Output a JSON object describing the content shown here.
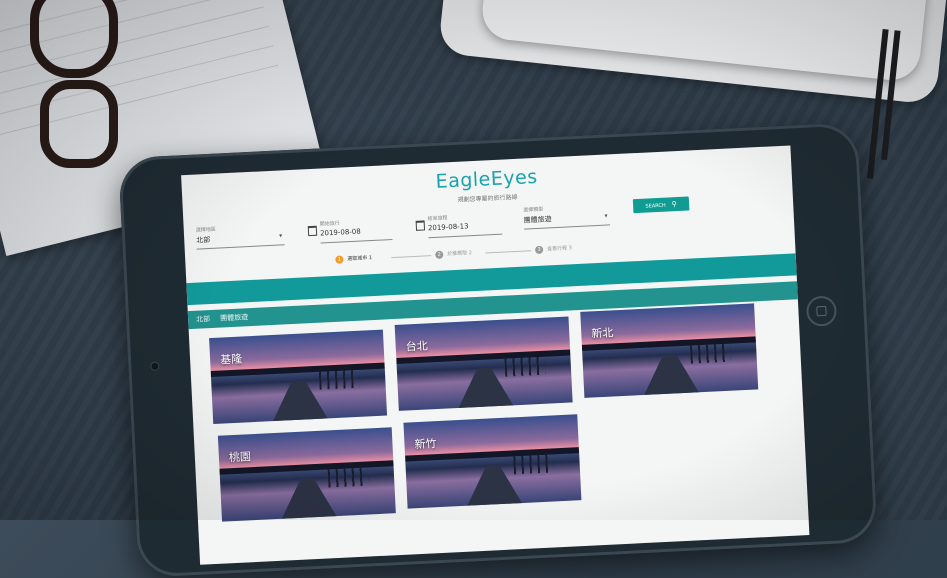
{
  "app": {
    "brand": "EagleEyes",
    "subtitle": "規劃您專屬的旅行路線"
  },
  "form": {
    "region": {
      "label": "選擇地區",
      "value": "北部"
    },
    "start_date": {
      "label": "開始旅行",
      "value": "2019-08-08"
    },
    "end_date": {
      "label": "結束旅程",
      "value": "2019-08-13"
    },
    "category": {
      "label": "選擇類型",
      "value": "團體旅遊"
    },
    "search_label": "SEARCH"
  },
  "steps": [
    {
      "num": "1",
      "label": "選取城市 1",
      "active": true
    },
    {
      "num": "2",
      "label": "於推薦取 2",
      "active": false
    },
    {
      "num": "3",
      "label": "查看行程 3",
      "active": false
    }
  ],
  "breadcrumb": [
    "北部",
    "團體旅遊"
  ],
  "cities": [
    "基隆",
    "台北",
    "新北",
    "桃園",
    "新竹"
  ],
  "colors": {
    "accent": "#129a9a",
    "brand": "#19a3ad",
    "step_active": "#f29b2b"
  }
}
